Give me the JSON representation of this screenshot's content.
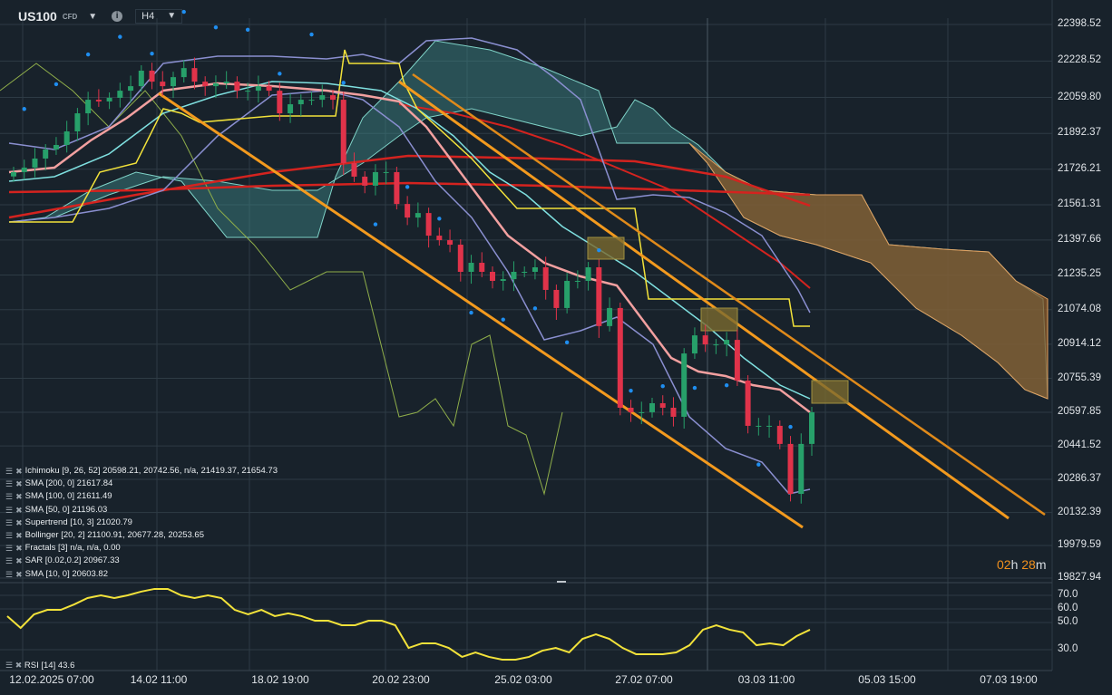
{
  "header": {
    "symbol": "US100",
    "type": "CFD",
    "timeframe": "H4"
  },
  "indicators": [
    "Ichimoku  [9, 26, 52] 20598.21,  20742.56,  n/a, 21419.37,  21654.73",
    "SMA [200, 0] 21617.84",
    "SMA [100, 0] 21611.49",
    "SMA [50, 0] 21196.03",
    "Supertrend  [10, 3] 21020.79",
    "Bollinger  [20, 2] 21100.91,  20677.28,  20253.65",
    "Fractals  [3] n/a, n/a, 0.00",
    "SAR [0.02,0.2]  20967.33",
    "SMA [10, 0] 20603.82"
  ],
  "rsi_legend": "RSI [14] 43.6",
  "timer": {
    "h": "02",
    "hu": "h",
    "m": "28",
    "mu": "m"
  },
  "colors": {
    "bull": "#27a06a",
    "bear": "#e0334a",
    "channel": "#f39a1e",
    "sma200": "#d4231f",
    "supertrend": "#f2e23a",
    "sar": "#1f8ef0",
    "rsi": "#f2e23a"
  },
  "price_axis": [
    "22398.52",
    "22228.52",
    "22059.80",
    "21892.37",
    "21726.21",
    "21561.31",
    "21397.66",
    "21235.25",
    "21074.08",
    "20914.12",
    "20755.39",
    "20597.85",
    "20441.52",
    "20286.37",
    "20132.39",
    "19979.59",
    "19827.94"
  ],
  "rsi_axis": [
    "70.0",
    "60.0",
    "50.0",
    "30.0"
  ],
  "time_axis": [
    "12.02.2025  07:00",
    "14.02  11:00",
    "18.02  19:00",
    "20.02  23:00",
    "25.02  03:00",
    "27.02  07:00",
    "03.03  11:00",
    "05.03  15:00",
    "07.03  19:00"
  ],
  "chart_data": {
    "type": "candlestick",
    "closes": [
      21713,
      21734,
      21776,
      21818,
      21839,
      21902,
      21986,
      22049,
      22041,
      22058,
      22091,
      22112,
      22184,
      22133,
      22112,
      22154,
      22196,
      22133,
      22112,
      22125,
      22133,
      22091,
      22091,
      22112,
      22091,
      21986,
      22028,
      22049,
      22049,
      22070,
      22049,
      21755,
      21692,
      21650,
      21713,
      21713,
      21565,
      21502,
      21523,
      21418,
      21397,
      21376,
      21250,
      21292,
      21250,
      21208,
      21216,
      21250,
      21250,
      21271,
      21166,
      21082,
      21208,
      21208,
      21271,
      20998,
      21082,
      20619,
      20598,
      20598,
      20640,
      20619,
      20577,
      20871,
      20955,
      20913,
      20913,
      20934,
      20745,
      20535,
      20535,
      20535,
      20451,
      20219,
      20451,
      20598
    ],
    "rsi": [
      54.7,
      46,
      56,
      59.3,
      59.3,
      63.3,
      68,
      70,
      68,
      70,
      72.7,
      74.7,
      74.7,
      70,
      68,
      70,
      68,
      59.3,
      56,
      59.3,
      54.7,
      56.7,
      54.7,
      51.3,
      51.3,
      48,
      48,
      51.3,
      51.3,
      48,
      31.3,
      34.7,
      34.7,
      31.3,
      24.7,
      28,
      24.7,
      22.7,
      22.7,
      24.7,
      29.3,
      31.3,
      28,
      38,
      41.3,
      38,
      31.3,
      26.7,
      26.7,
      26.7,
      28,
      33.3,
      44.7,
      48,
      44.7,
      42.7,
      33.3,
      34.7,
      33.3,
      40,
      44.7
    ],
    "ylim": [
      19827.94,
      22398.52
    ],
    "rsi_ylim": [
      30,
      70
    ]
  }
}
